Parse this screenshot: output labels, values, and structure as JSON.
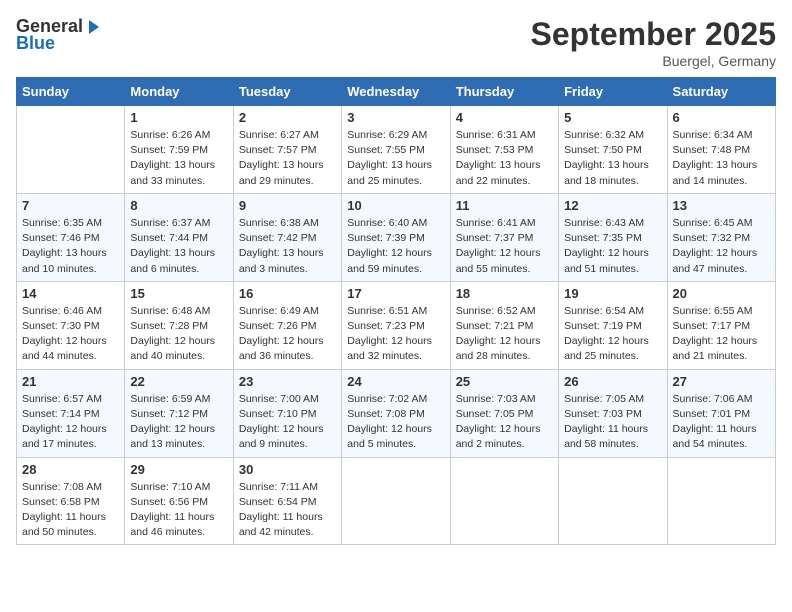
{
  "header": {
    "logo_line1": "General",
    "logo_line2": "Blue",
    "month": "September 2025",
    "location": "Buergel, Germany"
  },
  "weekdays": [
    "Sunday",
    "Monday",
    "Tuesday",
    "Wednesday",
    "Thursday",
    "Friday",
    "Saturday"
  ],
  "weeks": [
    [
      {
        "day": "",
        "info": ""
      },
      {
        "day": "1",
        "info": "Sunrise: 6:26 AM\nSunset: 7:59 PM\nDaylight: 13 hours and 33 minutes."
      },
      {
        "day": "2",
        "info": "Sunrise: 6:27 AM\nSunset: 7:57 PM\nDaylight: 13 hours and 29 minutes."
      },
      {
        "day": "3",
        "info": "Sunrise: 6:29 AM\nSunset: 7:55 PM\nDaylight: 13 hours and 25 minutes."
      },
      {
        "day": "4",
        "info": "Sunrise: 6:31 AM\nSunset: 7:53 PM\nDaylight: 13 hours and 22 minutes."
      },
      {
        "day": "5",
        "info": "Sunrise: 6:32 AM\nSunset: 7:50 PM\nDaylight: 13 hours and 18 minutes."
      },
      {
        "day": "6",
        "info": "Sunrise: 6:34 AM\nSunset: 7:48 PM\nDaylight: 13 hours and 14 minutes."
      }
    ],
    [
      {
        "day": "7",
        "info": "Sunrise: 6:35 AM\nSunset: 7:46 PM\nDaylight: 13 hours and 10 minutes."
      },
      {
        "day": "8",
        "info": "Sunrise: 6:37 AM\nSunset: 7:44 PM\nDaylight: 13 hours and 6 minutes."
      },
      {
        "day": "9",
        "info": "Sunrise: 6:38 AM\nSunset: 7:42 PM\nDaylight: 13 hours and 3 minutes."
      },
      {
        "day": "10",
        "info": "Sunrise: 6:40 AM\nSunset: 7:39 PM\nDaylight: 12 hours and 59 minutes."
      },
      {
        "day": "11",
        "info": "Sunrise: 6:41 AM\nSunset: 7:37 PM\nDaylight: 12 hours and 55 minutes."
      },
      {
        "day": "12",
        "info": "Sunrise: 6:43 AM\nSunset: 7:35 PM\nDaylight: 12 hours and 51 minutes."
      },
      {
        "day": "13",
        "info": "Sunrise: 6:45 AM\nSunset: 7:32 PM\nDaylight: 12 hours and 47 minutes."
      }
    ],
    [
      {
        "day": "14",
        "info": "Sunrise: 6:46 AM\nSunset: 7:30 PM\nDaylight: 12 hours and 44 minutes."
      },
      {
        "day": "15",
        "info": "Sunrise: 6:48 AM\nSunset: 7:28 PM\nDaylight: 12 hours and 40 minutes."
      },
      {
        "day": "16",
        "info": "Sunrise: 6:49 AM\nSunset: 7:26 PM\nDaylight: 12 hours and 36 minutes."
      },
      {
        "day": "17",
        "info": "Sunrise: 6:51 AM\nSunset: 7:23 PM\nDaylight: 12 hours and 32 minutes."
      },
      {
        "day": "18",
        "info": "Sunrise: 6:52 AM\nSunset: 7:21 PM\nDaylight: 12 hours and 28 minutes."
      },
      {
        "day": "19",
        "info": "Sunrise: 6:54 AM\nSunset: 7:19 PM\nDaylight: 12 hours and 25 minutes."
      },
      {
        "day": "20",
        "info": "Sunrise: 6:55 AM\nSunset: 7:17 PM\nDaylight: 12 hours and 21 minutes."
      }
    ],
    [
      {
        "day": "21",
        "info": "Sunrise: 6:57 AM\nSunset: 7:14 PM\nDaylight: 12 hours and 17 minutes."
      },
      {
        "day": "22",
        "info": "Sunrise: 6:59 AM\nSunset: 7:12 PM\nDaylight: 12 hours and 13 minutes."
      },
      {
        "day": "23",
        "info": "Sunrise: 7:00 AM\nSunset: 7:10 PM\nDaylight: 12 hours and 9 minutes."
      },
      {
        "day": "24",
        "info": "Sunrise: 7:02 AM\nSunset: 7:08 PM\nDaylight: 12 hours and 5 minutes."
      },
      {
        "day": "25",
        "info": "Sunrise: 7:03 AM\nSunset: 7:05 PM\nDaylight: 12 hours and 2 minutes."
      },
      {
        "day": "26",
        "info": "Sunrise: 7:05 AM\nSunset: 7:03 PM\nDaylight: 11 hours and 58 minutes."
      },
      {
        "day": "27",
        "info": "Sunrise: 7:06 AM\nSunset: 7:01 PM\nDaylight: 11 hours and 54 minutes."
      }
    ],
    [
      {
        "day": "28",
        "info": "Sunrise: 7:08 AM\nSunset: 6:58 PM\nDaylight: 11 hours and 50 minutes."
      },
      {
        "day": "29",
        "info": "Sunrise: 7:10 AM\nSunset: 6:56 PM\nDaylight: 11 hours and 46 minutes."
      },
      {
        "day": "30",
        "info": "Sunrise: 7:11 AM\nSunset: 6:54 PM\nDaylight: 11 hours and 42 minutes."
      },
      {
        "day": "",
        "info": ""
      },
      {
        "day": "",
        "info": ""
      },
      {
        "day": "",
        "info": ""
      },
      {
        "day": "",
        "info": ""
      }
    ]
  ]
}
